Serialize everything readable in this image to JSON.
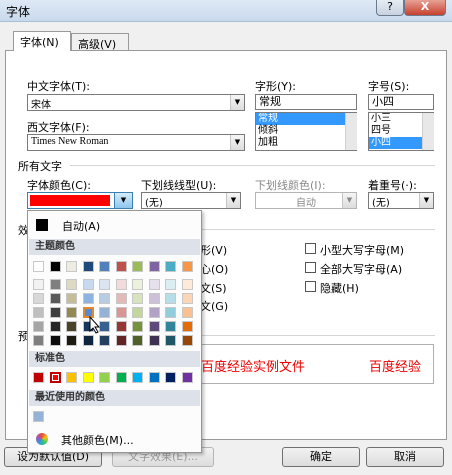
{
  "window": {
    "title": "字体",
    "help_label": "?",
    "close_label": "X"
  },
  "tabs": [
    {
      "label": "字体(N)"
    },
    {
      "label": "高级(V)"
    }
  ],
  "font": {
    "cn_font_label": "中文字体(T):",
    "cn_font_value": "宋体",
    "west_font_label": "西文字体(F):",
    "west_font_value": "Times New Roman",
    "style_label": "字形(Y):",
    "style_value": "常规",
    "style_options": [
      "常规",
      "倾斜",
      "加粗"
    ],
    "size_label": "字号(S):",
    "size_value": "小四",
    "size_options": [
      "小三",
      "四号",
      "小四"
    ]
  },
  "all_text": {
    "section": "所有文字",
    "color_label": "字体颜色(C):",
    "font_color": "#ff0000",
    "underline_label": "下划线线型(U):",
    "underline_value": "(无)",
    "underline_color_label": "下划线颜色(I):",
    "underline_color_value": "自动",
    "emphasis_label": "着重号(·):",
    "emphasis_value": "(无)"
  },
  "effects": {
    "section_partial": "效",
    "partial_labels": [
      "形(V)",
      "心(O)",
      "文(S)",
      "文(G)"
    ],
    "small_caps": "小型大写字母(M)",
    "all_caps": "全部大写字母(A)",
    "hidden": "隐藏(H)"
  },
  "preview": {
    "section_partial": "预",
    "text_left": "百度经验实例文件",
    "text_right": "百度经验"
  },
  "buttons": {
    "set_default": "设为默认值(D)",
    "text_effects": "文字效果(E)...",
    "ok": "确定",
    "cancel": "取消"
  },
  "color_popup": {
    "auto_label": "自动(A)",
    "theme_header": "主题颜色",
    "theme_colors": [
      [
        "#ffffff",
        "#f2f2f2",
        "#d8d8d8",
        "#bfbfbf",
        "#a5a5a5",
        "#7f7f7f"
      ],
      [
        "#000000",
        "#7f7f7f",
        "#595959",
        "#3f3f3f",
        "#262626",
        "#0c0c0c"
      ],
      [
        "#eeece1",
        "#ddd9c3",
        "#c4bd97",
        "#938953",
        "#494429",
        "#1d1b10"
      ],
      [
        "#1f497d",
        "#c6d9f0",
        "#8db3e2",
        "#548dd4",
        "#17365d",
        "#0f243e"
      ],
      [
        "#4f81bd",
        "#dbe5f1",
        "#b8cce4",
        "#95b3d7",
        "#366092",
        "#244061"
      ],
      [
        "#c0504d",
        "#f2dcdb",
        "#e5b9b7",
        "#d99694",
        "#953734",
        "#632423"
      ],
      [
        "#9bbb59",
        "#ebf1dd",
        "#d7e3bc",
        "#c3d69b",
        "#76923c",
        "#4f6128"
      ],
      [
        "#8064a2",
        "#e5e0ec",
        "#ccc1d9",
        "#b2a2c7",
        "#5f497a",
        "#3f3151"
      ],
      [
        "#4bacc6",
        "#dbeef3",
        "#b7dde8",
        "#92cddc",
        "#31859b",
        "#205867"
      ],
      [
        "#f79646",
        "#fdeada",
        "#fbd5b5",
        "#fac08f",
        "#e36c09",
        "#974806"
      ]
    ],
    "standard_header": "标准色",
    "standard_colors": [
      "#c00000",
      "#ff0000",
      "#ffc000",
      "#ffff00",
      "#92d050",
      "#00b050",
      "#00b0f0",
      "#0070c0",
      "#002060",
      "#7030a0"
    ],
    "recent_header": "最近使用的颜色",
    "recent_colors": [
      "#95b3d7"
    ],
    "more_label": "其他颜色(M)..."
  }
}
